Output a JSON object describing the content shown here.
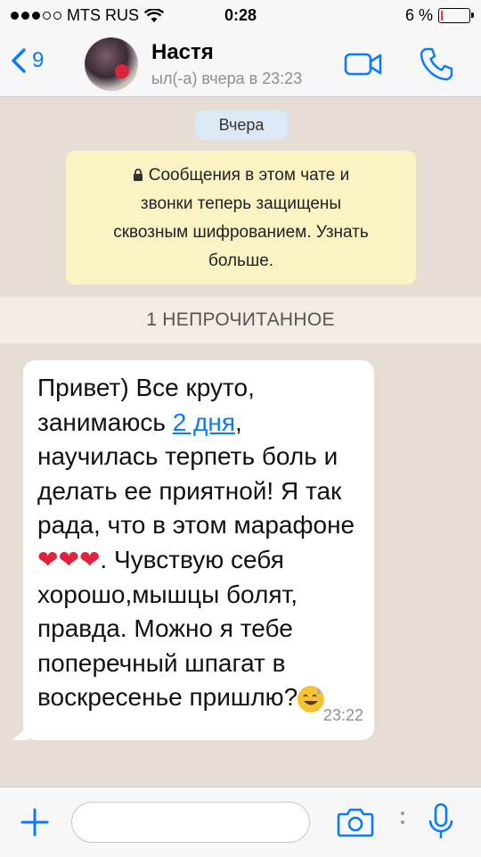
{
  "status_bar": {
    "carrier": "MTS RUS",
    "time": "0:28",
    "battery_percent_label": "6 %",
    "battery_level": 0.06,
    "signal_bars_filled": 3,
    "signal_bars_total": 5
  },
  "header": {
    "back_count": "9",
    "contact_name": "Настя",
    "last_seen": "ыл(-а) вчера в 23:23",
    "accent_color": "#0a7aff"
  },
  "chat": {
    "date_pill": "Вчера",
    "system_note_lines": [
      "Сообщения в этом чате и",
      "звонки теперь защищены",
      "сквозным шифрованием. Узнать",
      "больше."
    ],
    "unread_banner": "1 НЕПРОЧИТАННОЕ",
    "message": {
      "line1": "Привет) Все круто,",
      "line2_before": "занимаюсь ",
      "line2_link": "2 дня",
      "line2_after": ",",
      "line3": "научилась терпеть боль и",
      "line4": "делать ее приятной! Я так",
      "line5": "рада, что в этом марафоне",
      "line6_after_hearts": ". Чувствую себя",
      "line7": "хорошо,мышцы болят,",
      "line8": "правда. Можно я тебе",
      "line9": "поперечный шпагат в",
      "line10": "воскресенье пришлю?",
      "time": "23:22",
      "hearts": [
        "❤",
        "❤",
        "❤"
      ],
      "emoji_name": "sweat-smile-emoji"
    }
  },
  "input_bar": {
    "placeholder": ""
  },
  "icons": {
    "back": "chevron-left-icon",
    "video": "video-camera-icon",
    "call": "phone-icon",
    "plus": "plus-icon",
    "camera": "camera-icon",
    "mic": "microphone-icon",
    "lock": "lock-icon",
    "wifi": "wifi-icon"
  }
}
